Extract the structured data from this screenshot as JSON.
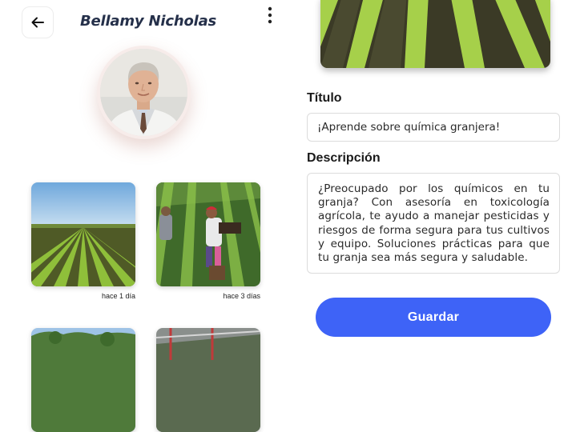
{
  "header": {
    "back_icon": "arrow-left-icon",
    "profile_name": "Bellamy Nicholas",
    "more_icon": "more-vertical-icon"
  },
  "profile": {
    "avatar": "doctor-portrait"
  },
  "posts": [
    {
      "image": "crop-field-rows",
      "time": "hace 1 día"
    },
    {
      "image": "farm-workers-harvest",
      "time": "hace 3 días"
    },
    {
      "image": "hillside-trees",
      "time": ""
    },
    {
      "image": "greenhouse",
      "time": ""
    }
  ],
  "form": {
    "title_label": "Título",
    "title_value": "¡Aprende sobre química granjera!",
    "description_label": "Descripción",
    "description_value": "¿Preocupado por los químicos en tu granja? Con asesoría en toxicología agrícola, te ayudo a manejar pesticidas y riesgos de forma segura para tus cultivos y equipo. Soluciones prácticas para que tu granja sea más segura y saludable.",
    "save_label": "Guardar"
  },
  "colors": {
    "accent": "#3e63f7",
    "name_text": "#25304a"
  }
}
